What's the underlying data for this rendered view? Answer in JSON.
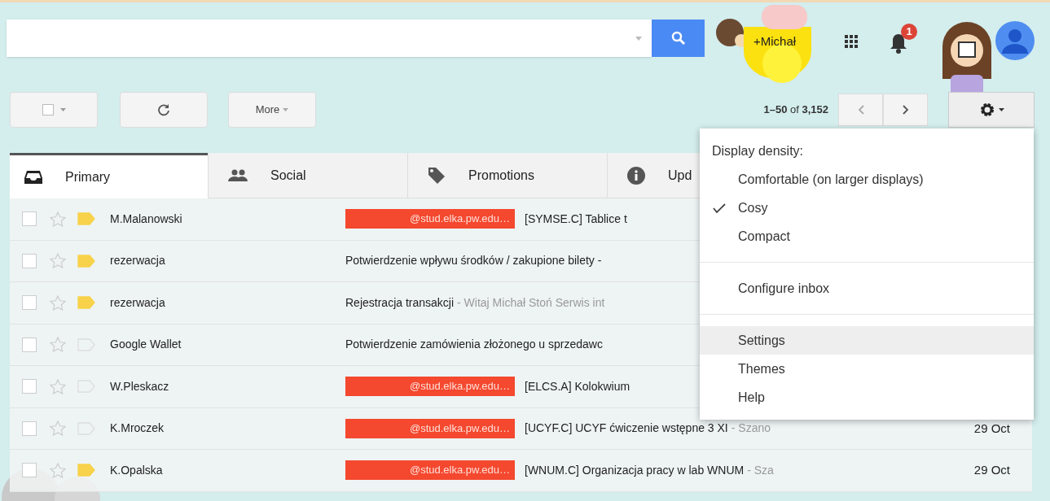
{
  "header": {
    "account": "+Michał",
    "notifications": "1"
  },
  "toolbar": {
    "select_all_checked": false,
    "more": "More",
    "range": "1–50",
    "of": "of",
    "total": "3,152"
  },
  "tabs": [
    {
      "label": "Primary",
      "kind": "inbox",
      "selected": true
    },
    {
      "label": "Social",
      "kind": "people",
      "selected": false
    },
    {
      "label": "Promotions",
      "kind": "tag",
      "selected": false
    },
    {
      "label": "Upd",
      "kind": "info",
      "selected": false
    }
  ],
  "rows": [
    {
      "sender": "M.Malanowski",
      "checked": false,
      "starred": false,
      "important": true,
      "label": "@stud.elka.pw.edu…",
      "subject": "[SYMSE.C] Tablice t"
    },
    {
      "sender": "rezerwacja",
      "checked": false,
      "starred": false,
      "important": true,
      "subject": "Potwierdzenie wpływu środków / zakupione bilety -"
    },
    {
      "sender": "rezerwacja",
      "checked": false,
      "starred": false,
      "important": true,
      "subject": "Rejestracja transakcji",
      "snippet": "- Witaj Michał Stoń Serwis int"
    },
    {
      "sender": "Google Wallet",
      "checked": false,
      "starred": false,
      "important": false,
      "subject": "Potwierdzenie zamówienia złożonego u sprzedawc"
    },
    {
      "sender": "W.Pleskacz",
      "checked": false,
      "starred": false,
      "important": false,
      "label": "@stud.elka.pw.edu…",
      "subject": "[ELCS.A] Kolokwium"
    },
    {
      "sender": "K.Mroczek",
      "checked": false,
      "starred": false,
      "important": false,
      "label": "@stud.elka.pw.edu…",
      "subject": "[UCYF.C] UCYF ćwiczenie wstępne 3 XI",
      "snippet": "- Szano",
      "date": "29 Oct"
    },
    {
      "sender": "K.Opalska",
      "checked": false,
      "starred": false,
      "important": true,
      "label": "@stud.elka.pw.edu…",
      "subject": "[WNUM.C] Organizacja pracy w lab WNUM",
      "snippet": "- Sza",
      "date": "29 Oct"
    }
  ],
  "menu": [
    {
      "kind": "heading",
      "label": "Display density:"
    },
    {
      "kind": "option",
      "label": "Comfortable (on larger displays)",
      "checked": false,
      "selected": false
    },
    {
      "kind": "option",
      "label": "Cosy",
      "checked": true,
      "selected": false
    },
    {
      "kind": "option",
      "label": "Compact",
      "checked": false,
      "selected": false
    },
    {
      "kind": "divider"
    },
    {
      "kind": "option",
      "label": "Configure inbox",
      "checked": false,
      "selected": false
    },
    {
      "kind": "divider"
    },
    {
      "kind": "option",
      "label": "Settings",
      "checked": false,
      "selected": true
    },
    {
      "kind": "option",
      "label": "Themes",
      "checked": false,
      "selected": false
    },
    {
      "kind": "option",
      "label": "Help",
      "checked": false,
      "selected": false
    }
  ]
}
